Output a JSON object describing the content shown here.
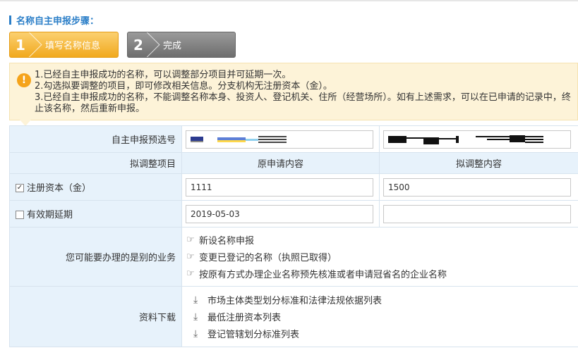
{
  "section": {
    "title": "名称自主申报步骤："
  },
  "steps": [
    {
      "num": "1",
      "label": "填写名称信息",
      "state": "active",
      "color": "#f1a91e"
    },
    {
      "num": "2",
      "label": "完成",
      "state": "inactive",
      "color": "#777777"
    }
  ],
  "notice": {
    "icon": "warning-icon",
    "lines": [
      "1.已经自主申报成功的名称，可以调整部分项目并可延期一次。",
      "2.勾选拟要调整的项目，即可修改相关信息。分支机构无注册资本（金）。",
      "3.已经自主申报成功的名称，不能调整名称本身、投资人、登记机关、住所（经营场所）。如有上述需求，可以在已申请的记录中，终止该名称，然后重新申报。"
    ]
  },
  "form": {
    "preselect_label": "自主申报预选号",
    "col_item": "拟调整项目",
    "col_original": "原申请内容",
    "col_adjusted": "拟调整内容",
    "rows": [
      {
        "label": "注册资本（金）",
        "checked": true,
        "check_mark": "✓",
        "original": "1111",
        "adjusted": "1500"
      },
      {
        "label": "有效期延期",
        "checked": false,
        "check_mark": "",
        "original": "2019-05-03",
        "adjusted": ""
      }
    ],
    "other_business_label": "您可能要办理的是别的业务",
    "other_business_links": [
      "新设名称申报",
      "变更已登记的名称（执照已取得）",
      "按原有方式办理企业名称预先核准或者申请冠省名的企业名称"
    ],
    "downloads_label": "资料下载",
    "downloads": [
      "市场主体类型划分标准和法律法规依据列表",
      "最低注册资本列表",
      "登记管辖划分标准列表"
    ]
  },
  "icons": {
    "pointer": "☞",
    "download": "⤓"
  },
  "colors": {
    "accent": "#2c7fc8",
    "label_bg": "#e7f2fb",
    "notice_bg": "#fdf3d8"
  }
}
